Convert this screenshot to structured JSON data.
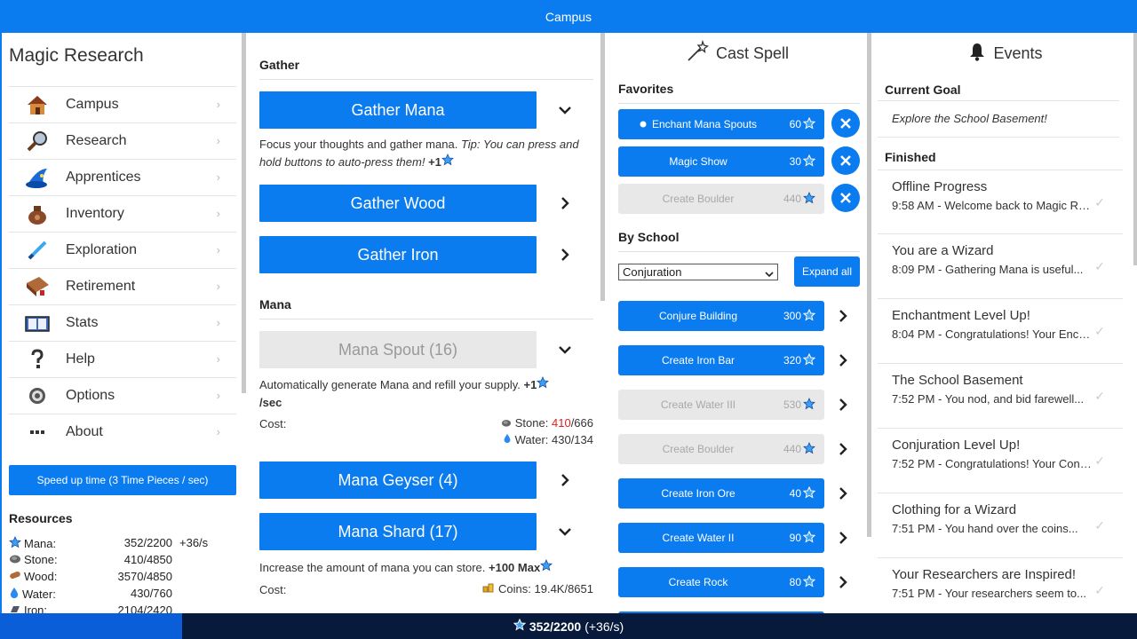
{
  "topbar": {
    "title": "Campus"
  },
  "app_title": "Magic Research",
  "nav": [
    {
      "label": "Campus",
      "icon": "house-icon"
    },
    {
      "label": "Research",
      "icon": "magnifier-icon"
    },
    {
      "label": "Apprentices",
      "icon": "wizard-hat-icon"
    },
    {
      "label": "Inventory",
      "icon": "bag-icon"
    },
    {
      "label": "Exploration",
      "icon": "sword-icon"
    },
    {
      "label": "Retirement",
      "icon": "book-icon"
    },
    {
      "label": "Stats",
      "icon": "open-book-icon"
    },
    {
      "label": "Help",
      "icon": "question-icon"
    },
    {
      "label": "Options",
      "icon": "gear-icon"
    },
    {
      "label": "About",
      "icon": "ellipsis-icon"
    }
  ],
  "speed_button": "Speed up time (3 Time Pieces / sec)",
  "resources": {
    "heading": "Resources",
    "items": [
      {
        "name": "Mana:",
        "value": "352/2200",
        "rate": "+36/s",
        "icon": "mana-star-icon"
      },
      {
        "name": "Stone:",
        "value": "410/4850",
        "rate": "",
        "icon": "stone-icon"
      },
      {
        "name": "Wood:",
        "value": "3570/4850",
        "rate": "",
        "icon": "wood-icon"
      },
      {
        "name": "Water:",
        "value": "430/760",
        "rate": "",
        "icon": "water-drop-icon"
      },
      {
        "name": "Iron:",
        "value": "2104/2420",
        "rate": "",
        "icon": "iron-icon"
      }
    ]
  },
  "gather": {
    "heading": "Gather",
    "gather_mana": "Gather Mana",
    "gather_mana_desc": "Focus your thoughts and gather mana.",
    "gather_mana_tip": "Tip: You can press and hold buttons to auto-press them!",
    "gather_mana_gain": "+1",
    "gather_wood": "Gather Wood",
    "gather_iron": "Gather Iron"
  },
  "mana": {
    "heading": "Mana",
    "spout": "Mana Spout (16)",
    "spout_desc": "Automatically generate Mana and refill your supply.",
    "spout_gain": "+1",
    "spout_unit": "/sec",
    "cost_label": "Cost:",
    "spout_cost_stone_label": "Stone:",
    "spout_cost_stone_have": "410",
    "spout_cost_stone_need": "/666",
    "spout_cost_water": "Water: 430/134",
    "geyser": "Mana Geyser (4)",
    "shard": "Mana Shard (17)",
    "shard_desc": "Increase the amount of mana you can store.",
    "shard_gain": "+100 Max",
    "shard_cost_label": "Cost:",
    "shard_cost_coins": "Coins: 19.4K/8651"
  },
  "spells": {
    "heading": "Cast Spell",
    "favorites_heading": "Favorites",
    "favorites": [
      {
        "name": "Enchant Mana Spouts",
        "cost": "60",
        "disabled": false,
        "active": true
      },
      {
        "name": "Magic Show",
        "cost": "30",
        "disabled": false,
        "active": false
      },
      {
        "name": "Create Boulder",
        "cost": "440",
        "disabled": true,
        "active": false
      }
    ],
    "by_school_heading": "By School",
    "school_selected": "Conjuration",
    "expand_all": "Expand all",
    "school_spells": [
      {
        "name": "Conjure Building",
        "cost": "300",
        "disabled": false
      },
      {
        "name": "Create Iron Bar",
        "cost": "320",
        "disabled": false
      },
      {
        "name": "Create Water III",
        "cost": "530",
        "disabled": true
      },
      {
        "name": "Create Boulder",
        "cost": "440",
        "disabled": true
      },
      {
        "name": "Create Iron Ore",
        "cost": "40",
        "disabled": false
      },
      {
        "name": "Create Water II",
        "cost": "90",
        "disabled": false
      },
      {
        "name": "Create Rock",
        "cost": "80",
        "disabled": false
      }
    ]
  },
  "events": {
    "heading": "Events",
    "current_goal_heading": "Current Goal",
    "current_goal": "Explore the School Basement!",
    "finished_heading": "Finished",
    "finished": [
      {
        "title": "Offline Progress",
        "detail": "9:58 AM - Welcome back to Magic Research!"
      },
      {
        "title": "You are a Wizard",
        "detail": "8:09 PM - Gathering Mana is useful..."
      },
      {
        "title": "Enchantment Level Up!",
        "detail": "8:04 PM - Congratulations! Your Enchantment..."
      },
      {
        "title": "The School Basement",
        "detail": "7:52 PM - You nod, and bid farewell..."
      },
      {
        "title": "Conjuration Level Up!",
        "detail": "7:52 PM - Congratulations! Your Conjuration..."
      },
      {
        "title": "Clothing for a Wizard",
        "detail": "7:51 PM - You hand over the coins..."
      },
      {
        "title": "Your Researchers are Inspired!",
        "detail": "7:51 PM - Your researchers seem to..."
      }
    ]
  },
  "footer": {
    "mana": "352/2200",
    "rate": "(+36/s)",
    "progress": 0.16
  },
  "colors": {
    "accent": "#0a7cf0",
    "footer_bg": "#081a3c",
    "footer_fill": "#0a5fd8",
    "insufficient": "#e02020"
  }
}
